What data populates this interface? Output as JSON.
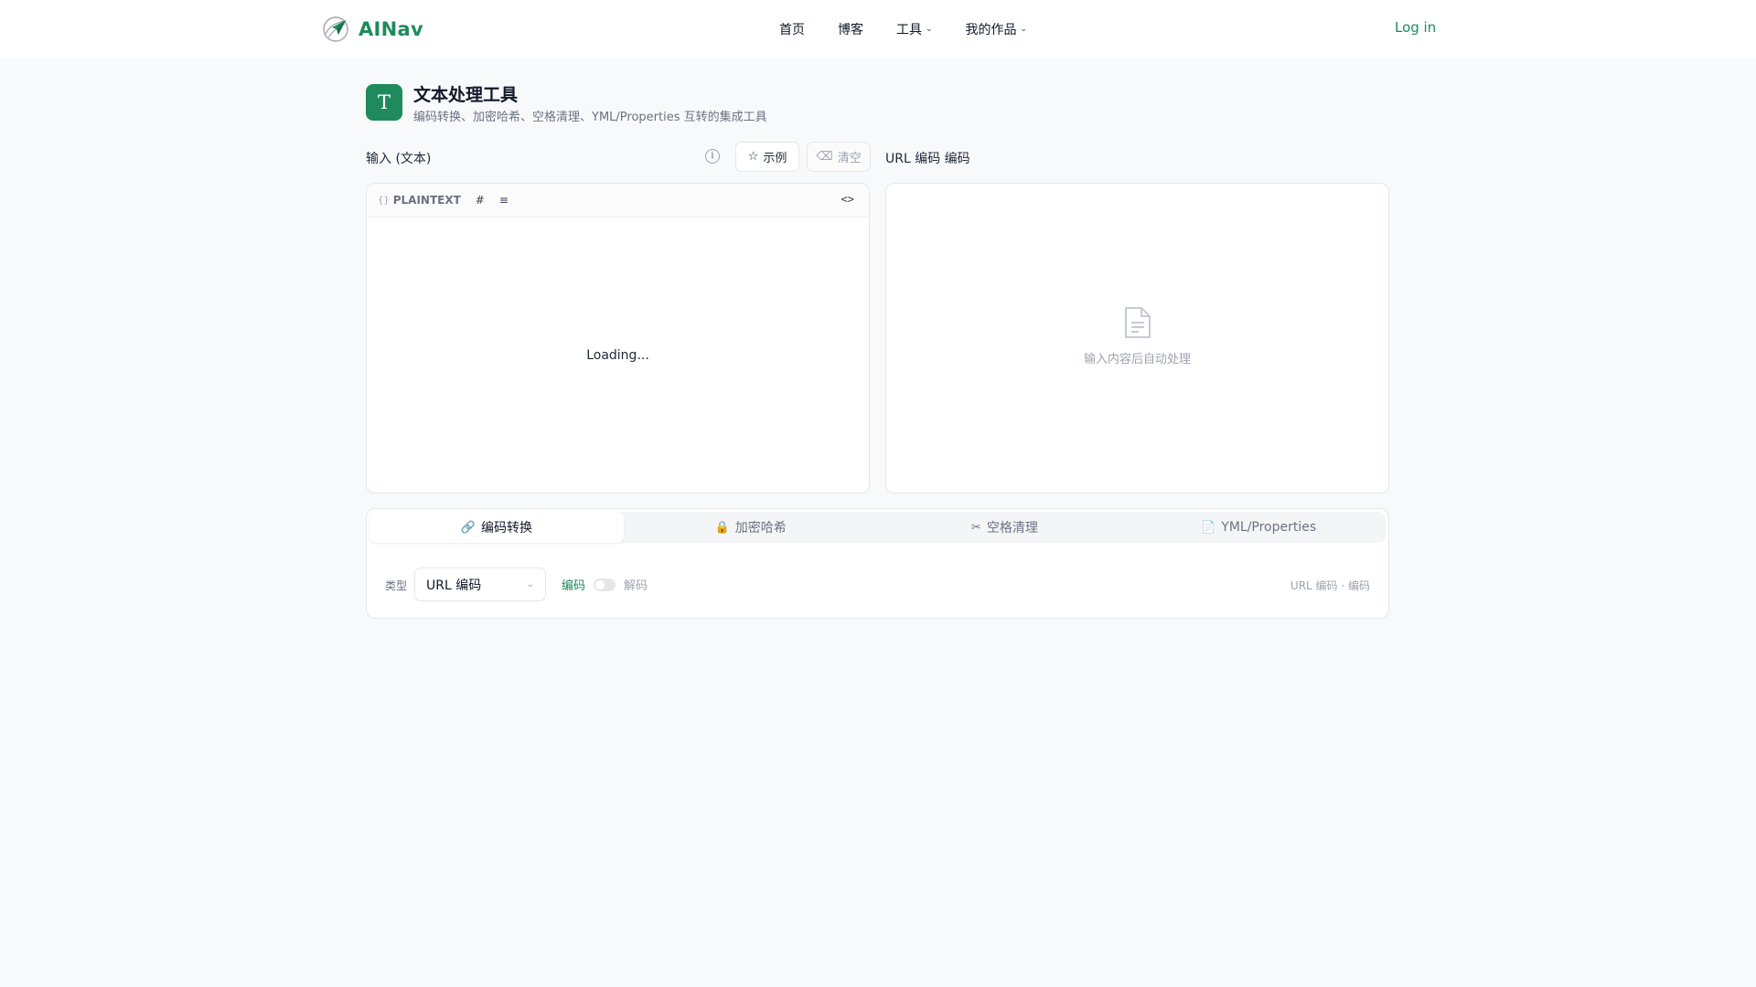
{
  "header": {
    "brand": "AINav",
    "nav": [
      {
        "label": "首页"
      },
      {
        "label": "博客"
      },
      {
        "label": "工具"
      },
      {
        "label": "我的作品"
      }
    ],
    "login": "Log in"
  },
  "page": {
    "icon_letter": "T",
    "title": "文本处理工具",
    "subtitle": "编码转换、加密哈希、空格清理、YML/Properties 互转的集成工具"
  },
  "toolbar": {
    "input_label": "输入 (文本)",
    "info_icon": "i",
    "example_label": "示例",
    "clear_label": "清空",
    "output_label": "URL 编码 编码"
  },
  "editor": {
    "language": "PLAINTEXT",
    "loading": "Loading..."
  },
  "output": {
    "empty_text": "输入内容后自动处理"
  },
  "tabs": [
    {
      "label": "编码转换",
      "active": true
    },
    {
      "label": "加密哈希",
      "active": false
    },
    {
      "label": "空格清理",
      "active": false
    },
    {
      "label": "YML/Properties",
      "active": false
    }
  ],
  "options": {
    "type_label": "类型",
    "type_value": "URL 编码",
    "encode_label": "编码",
    "decode_label": "解码",
    "summary": "URL 编码 · 编码"
  },
  "colors": {
    "brand": "#1f8a5b",
    "background": "#f8f9fb"
  }
}
